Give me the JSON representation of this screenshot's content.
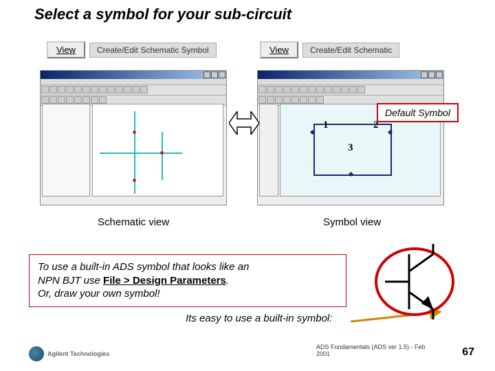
{
  "title": "Select a symbol for your sub-circuit",
  "menu_left": {
    "view": "View",
    "item": "Create/Edit Schematic Symbol"
  },
  "menu_right": {
    "view": "View",
    "item": "Create/Edit Schematic"
  },
  "callout": "Default Symbol",
  "caption_left": "Schematic view",
  "caption_right": "Symbol view",
  "symbol": {
    "pin1": "1",
    "pin2": "2",
    "pin3": "3"
  },
  "info": {
    "line1": "To use a built-in ADS symbol that looks like an",
    "line2a": "NPN BJT use ",
    "line2b": "File > Design Parameters",
    "line2c": ".",
    "line3": "Or, draw your own symbol!"
  },
  "subtext": "Its easy to use a built-in symbol:",
  "logo": {
    "name": "Agilent Technologies"
  },
  "footer": "ADS Fundamentals (ADS ver 1.5) - Feb 2001",
  "page": "67"
}
